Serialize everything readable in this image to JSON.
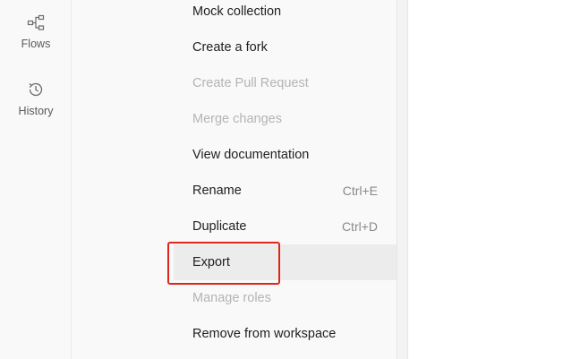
{
  "sidebar": {
    "items": [
      {
        "label": "Flows",
        "icon": "flows-icon"
      },
      {
        "label": "History",
        "icon": "history-icon"
      }
    ]
  },
  "menu": {
    "items": [
      {
        "label": "Mock collection",
        "shortcut": "",
        "disabled": false
      },
      {
        "label": "Create a fork",
        "shortcut": "",
        "disabled": false
      },
      {
        "label": "Create Pull Request",
        "shortcut": "",
        "disabled": true
      },
      {
        "label": "Merge changes",
        "shortcut": "",
        "disabled": true
      },
      {
        "label": "View documentation",
        "shortcut": "",
        "disabled": false
      },
      {
        "label": "Rename",
        "shortcut": "Ctrl+E",
        "disabled": false
      },
      {
        "label": "Duplicate",
        "shortcut": "Ctrl+D",
        "disabled": false
      },
      {
        "label": "Export",
        "shortcut": "",
        "disabled": false,
        "active": true
      },
      {
        "label": "Manage roles",
        "shortcut": "",
        "disabled": true
      },
      {
        "label": "Remove from workspace",
        "shortcut": "",
        "disabled": false
      }
    ]
  },
  "colors": {
    "highlight": "#e0251b",
    "text": "#212121",
    "disabled_text": "#b4b4b4",
    "active_bg": "#ececec"
  }
}
